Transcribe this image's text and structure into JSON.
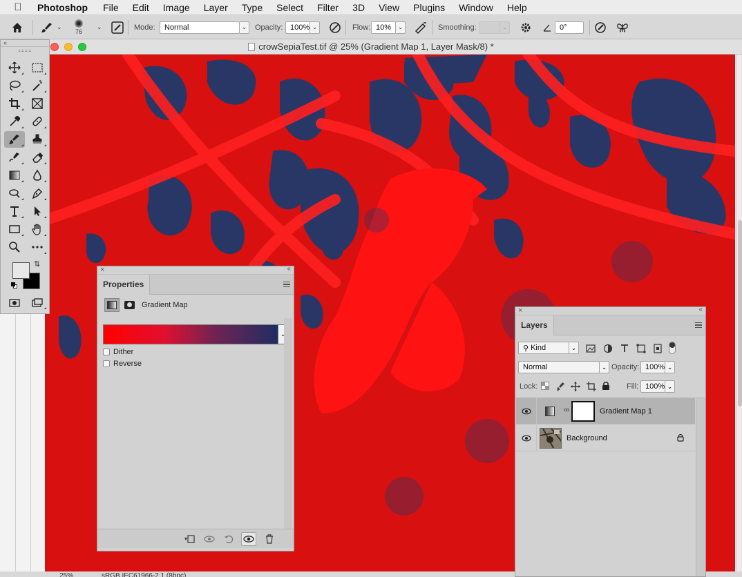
{
  "menubar": {
    "app_name": "Photoshop",
    "items": [
      "File",
      "Edit",
      "Image",
      "Layer",
      "Type",
      "Select",
      "Filter",
      "3D",
      "View",
      "Plugins",
      "Window",
      "Help"
    ]
  },
  "options": {
    "brush_size": "76",
    "mode_label": "Mode:",
    "mode_value": "Normal",
    "opacity_label": "Opacity:",
    "opacity_value": "100%",
    "flow_label": "Flow:",
    "flow_value": "10%",
    "smoothing_label": "Smoothing:",
    "smoothing_value": "",
    "angle_value": "0°"
  },
  "document": {
    "title": "crowSepiaTest.tif @ 25% (Gradient Map 1, Layer Mask/8) *",
    "zoom": "25%",
    "profile": "sRGB IEC61966-2.1 (8bpc)"
  },
  "colors": {
    "canvas_red": "#d81010",
    "canvas_navy": "#1f3a6b",
    "gradient_start": "#ff0000",
    "gradient_end": "#1f2d63",
    "foreground_swatch": "#e8e8e8",
    "background_swatch": "#000000"
  },
  "toolbar": {
    "tools": [
      "move-tool",
      "marquee-tool",
      "lasso-tool",
      "magic-wand-tool",
      "crop-tool",
      "frame-tool",
      "eyedropper-tool",
      "healing-brush-tool",
      "brush-tool",
      "clone-stamp-tool",
      "history-brush-tool",
      "eraser-tool",
      "gradient-tool",
      "blur-tool",
      "dodge-tool",
      "pen-tool",
      "type-tool",
      "path-selection-tool",
      "rectangle-tool",
      "hand-tool",
      "zoom-tool",
      "more-tools"
    ],
    "active_tool": "brush-tool"
  },
  "properties": {
    "tab": "Properties",
    "adjustment_label": "Gradient Map",
    "dither_label": "Dither",
    "reverse_label": "Reverse",
    "dither_checked": false,
    "reverse_checked": false
  },
  "layers": {
    "tab": "Layers",
    "filter_kind": "Kind",
    "blend_mode": "Normal",
    "opacity_label": "Opacity:",
    "opacity_value": "100%",
    "lock_label": "Lock:",
    "fill_label": "Fill:",
    "fill_value": "100%",
    "rows": [
      {
        "name": "Gradient Map 1",
        "selected": true,
        "visible": true,
        "locked": false
      },
      {
        "name": "Background",
        "selected": false,
        "visible": true,
        "locked": true
      }
    ]
  }
}
